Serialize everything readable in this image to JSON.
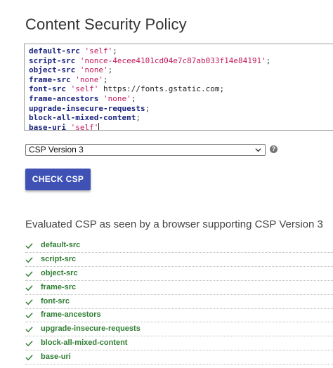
{
  "page": {
    "title": "Content Security Policy"
  },
  "policy_lines": [
    [
      {
        "t": "default-src",
        "c": "dir"
      },
      {
        "t": " ",
        "c": ""
      },
      {
        "t": "'self'",
        "c": "kw"
      },
      {
        "t": ";",
        "c": ""
      }
    ],
    [
      {
        "t": "script-src",
        "c": "dir"
      },
      {
        "t": " ",
        "c": ""
      },
      {
        "t": "'nonce-4ecee4101cd04e7c87ab033f14e84191'",
        "c": "kw"
      },
      {
        "t": ";",
        "c": ""
      }
    ],
    [
      {
        "t": "object-src",
        "c": "dir"
      },
      {
        "t": " ",
        "c": ""
      },
      {
        "t": "'none'",
        "c": "kw"
      },
      {
        "t": ";",
        "c": ""
      }
    ],
    [
      {
        "t": "frame-src",
        "c": "dir"
      },
      {
        "t": " ",
        "c": ""
      },
      {
        "t": "'none'",
        "c": "kw"
      },
      {
        "t": ";",
        "c": ""
      }
    ],
    [
      {
        "t": "font-src",
        "c": "dir"
      },
      {
        "t": " ",
        "c": ""
      },
      {
        "t": "'self'",
        "c": "kw"
      },
      {
        "t": " https://fonts.gstatic.com;",
        "c": "url"
      }
    ],
    [
      {
        "t": "frame-ancestors",
        "c": "dir"
      },
      {
        "t": " ",
        "c": ""
      },
      {
        "t": "'none'",
        "c": "kw"
      },
      {
        "t": ";",
        "c": ""
      }
    ],
    [
      {
        "t": "upgrade-insecure-requests",
        "c": "dir"
      },
      {
        "t": ";",
        "c": ""
      }
    ],
    [
      {
        "t": "block-all-mixed-content",
        "c": "dir"
      },
      {
        "t": ";",
        "c": ""
      }
    ],
    [
      {
        "t": "base-uri",
        "c": "dir"
      },
      {
        "t": " ",
        "c": ""
      },
      {
        "t": "'self'",
        "c": "kw"
      }
    ]
  ],
  "version_select": {
    "selected": "CSP Version 3"
  },
  "check_button": {
    "label": "CHECK CSP"
  },
  "evaluation": {
    "heading": "Evaluated CSP as seen by a browser supporting CSP Version 3",
    "status_color": "#2e7d32",
    "items": [
      "default-src",
      "script-src",
      "object-src",
      "frame-src",
      "font-src",
      "frame-ancestors",
      "upgrade-insecure-requests",
      "block-all-mixed-content",
      "base-uri"
    ]
  },
  "icons": {
    "help": "help-icon",
    "check": "check-icon",
    "dropdown": "chevron-down-icon"
  }
}
